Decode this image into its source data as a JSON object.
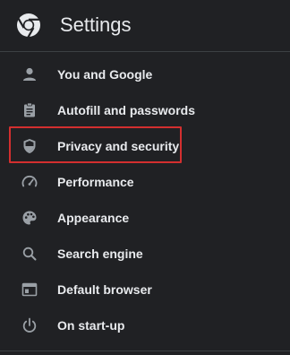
{
  "app": {
    "title": "Settings",
    "logo_icon": "chrome-logo-icon"
  },
  "menu": {
    "items": [
      {
        "label": "You and Google",
        "icon": "person-icon"
      },
      {
        "label": "Autofill and passwords",
        "icon": "clipboard-icon"
      },
      {
        "label": "Privacy and security",
        "icon": "shield-icon",
        "highlighted": true
      },
      {
        "label": "Performance",
        "icon": "speedometer-icon"
      },
      {
        "label": "Appearance",
        "icon": "palette-icon"
      },
      {
        "label": "Search engine",
        "icon": "search-icon"
      },
      {
        "label": "Default browser",
        "icon": "browser-window-icon"
      },
      {
        "label": "On start-up",
        "icon": "power-icon"
      }
    ]
  },
  "colors": {
    "background": "#202124",
    "text": "#e8eaed",
    "icon": "#9aa0a6",
    "highlight_border": "#d32f2f"
  }
}
